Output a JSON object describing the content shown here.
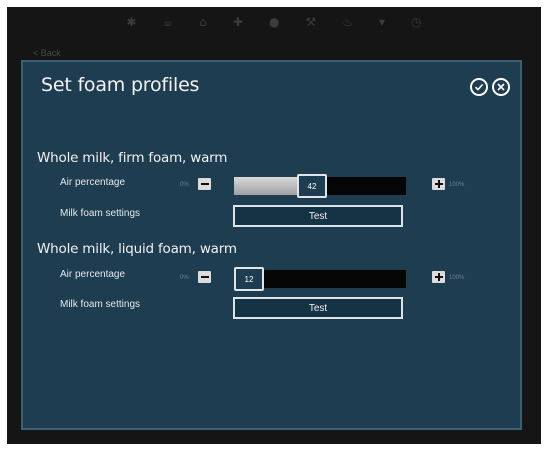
{
  "topbar": {
    "icons": [
      "star-icon",
      "cup-icon",
      "pot-icon",
      "plus-icon",
      "drop-icon",
      "wrench-icon",
      "coffee-icon",
      "cup-icon",
      "clock-icon"
    ]
  },
  "back_label": "< Back",
  "dialog": {
    "title": "Set foam profiles",
    "confirm_icon": "check-circle-icon",
    "close_icon": "close-circle-icon"
  },
  "profiles": [
    {
      "title": "Whole milk, firm foam, warm",
      "air_label": "Air percentage",
      "min_label": "0%",
      "max_label": "100%",
      "value_text": "42",
      "value_fraction": 0.42,
      "settings_label": "Milk foam settings",
      "test_label": "Test"
    },
    {
      "title": "Whole milk, liquid foam, warm",
      "air_label": "Air percentage",
      "min_label": "0%",
      "max_label": "100%",
      "value_text": "12",
      "value_fraction": 0.0,
      "settings_label": "Milk foam settings",
      "test_label": "Test"
    }
  ],
  "colors": {
    "dialog_bg": "#1f3d50",
    "screen_bg": "#151515",
    "track": "#050505",
    "fill": "#c4c4c4"
  }
}
